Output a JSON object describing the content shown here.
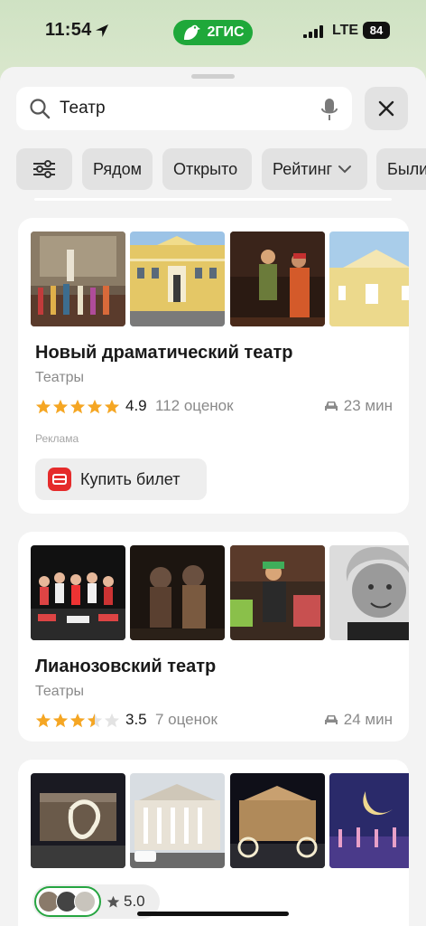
{
  "status_bar": {
    "time": "11:54",
    "brand": "2ГИС",
    "network": "LTE",
    "battery": "84"
  },
  "search": {
    "query": "Театр",
    "icon": "search-icon",
    "voice_icon": "mic-icon",
    "close_icon": "close-icon"
  },
  "filters": {
    "settings_icon": "sliders-icon",
    "chips": [
      "Рядом",
      "Открыто",
      "Рейтинг",
      "Были"
    ]
  },
  "results": [
    {
      "title": "Новый драматический театр",
      "category": "Театры",
      "rating": 4.9,
      "score_label": "4.9",
      "reviews": "112 оценок",
      "drive_time": "23 мин",
      "ad_label": "Реклама",
      "action_label": "Купить билет"
    },
    {
      "title": "Лианозовский театр",
      "category": "Театры",
      "rating": 3.5,
      "score_label": "3.5",
      "reviews": "7 оценок",
      "drive_time": "24 мин"
    },
    {
      "friends_score": "5.0"
    }
  ],
  "colors": {
    "brand_green": "#1fa83a",
    "star": "#f5a623",
    "star_empty": "#e3e3e3",
    "ticket_red": "#e52b2b"
  }
}
